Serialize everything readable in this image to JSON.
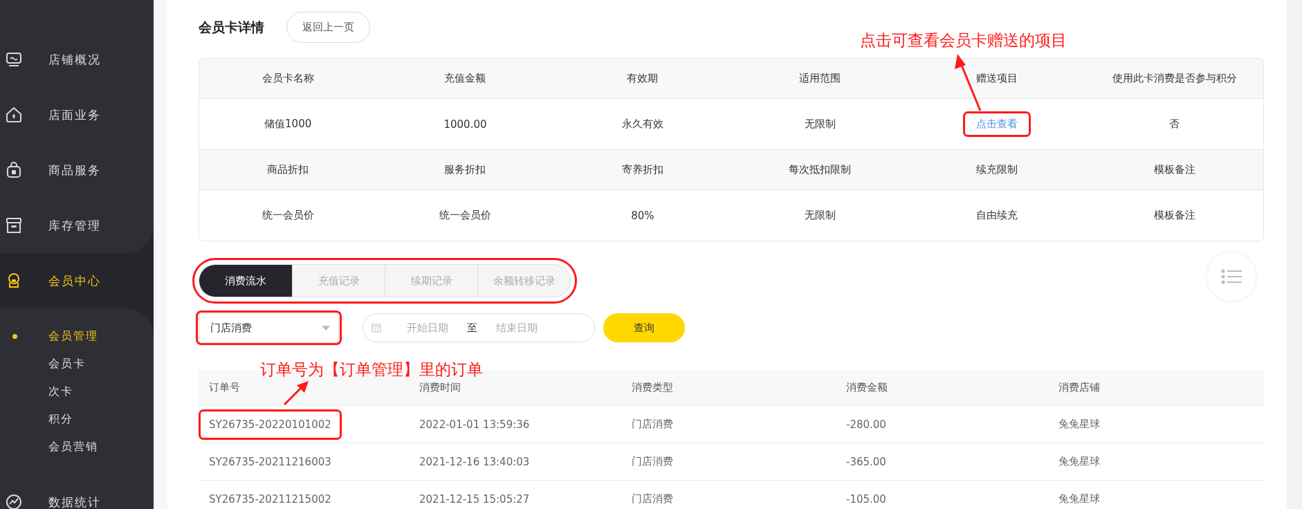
{
  "sidebar": {
    "items": [
      {
        "label": "店铺概况",
        "selected": false
      },
      {
        "label": "店面业务",
        "selected": false
      },
      {
        "label": "商品服务",
        "selected": false
      },
      {
        "label": "库存管理",
        "selected": false
      },
      {
        "label": "会员中心",
        "selected": true,
        "children": [
          {
            "label": "会员管理",
            "selected": true
          },
          {
            "label": "会员卡",
            "selected": false
          },
          {
            "label": "次卡",
            "selected": false
          },
          {
            "label": "积分",
            "selected": false
          },
          {
            "label": "会员营销",
            "selected": false
          }
        ]
      },
      {
        "label": "数据统计",
        "selected": false
      }
    ]
  },
  "page": {
    "title": "会员卡详情",
    "back_button": "返回上一页"
  },
  "card_table": {
    "rows": [
      {
        "kind": "header",
        "cells": [
          {
            "kind": "text",
            "text": "会员卡名称",
            "highlighted": false
          },
          {
            "kind": "text",
            "text": "充值金额",
            "highlighted": false
          },
          {
            "kind": "text",
            "text": "有效期",
            "highlighted": false
          },
          {
            "kind": "text",
            "text": "适用范围",
            "highlighted": false
          },
          {
            "kind": "text",
            "text": "赠送项目",
            "highlighted": false
          },
          {
            "kind": "text",
            "text": "使用此卡消费是否参与积分",
            "highlighted": false
          }
        ]
      },
      {
        "kind": "data",
        "cells": [
          {
            "kind": "text",
            "text": "储值1000",
            "highlighted": false
          },
          {
            "kind": "text",
            "text": "1000.00",
            "highlighted": false
          },
          {
            "kind": "text",
            "text": "永久有效",
            "highlighted": false
          },
          {
            "kind": "text",
            "text": "无限制",
            "highlighted": false
          },
          {
            "kind": "link",
            "text": "点击查看",
            "highlighted": true
          },
          {
            "kind": "text",
            "text": "否",
            "highlighted": false
          }
        ]
      },
      {
        "kind": "header",
        "cells": [
          {
            "kind": "text",
            "text": "商品折扣",
            "highlighted": false
          },
          {
            "kind": "text",
            "text": "服务折扣",
            "highlighted": false
          },
          {
            "kind": "text",
            "text": "寄养折扣",
            "highlighted": false
          },
          {
            "kind": "text",
            "text": "每次抵扣限制",
            "highlighted": false
          },
          {
            "kind": "text",
            "text": "续充限制",
            "highlighted": false
          },
          {
            "kind": "text",
            "text": "模板备注",
            "highlighted": false
          }
        ]
      },
      {
        "kind": "data",
        "cells": [
          {
            "kind": "text",
            "text": "统一会员价",
            "highlighted": false
          },
          {
            "kind": "text",
            "text": "统一会员价",
            "highlighted": false
          },
          {
            "kind": "text",
            "text": "80%",
            "highlighted": false
          },
          {
            "kind": "text",
            "text": "无限制",
            "highlighted": false
          },
          {
            "kind": "text",
            "text": "自由续充",
            "highlighted": false
          },
          {
            "kind": "text",
            "text": "模板备注",
            "highlighted": false
          }
        ]
      }
    ]
  },
  "record_tabs": {
    "highlighted": true,
    "tabs": [
      {
        "label": "消费流水",
        "selected": true
      },
      {
        "label": "充值记录",
        "selected": false
      },
      {
        "label": "续期记录",
        "selected": false
      },
      {
        "label": "余额转移记录",
        "selected": false
      }
    ]
  },
  "filters": {
    "type_select": {
      "value": "门店消费",
      "highlighted": true
    },
    "date_range": {
      "start_placeholder": "开始日期",
      "separator": "至",
      "end_placeholder": "结束日期"
    },
    "query_button": "查询"
  },
  "orders": {
    "columns": [
      "订单号",
      "消费时间",
      "消费类型",
      "消费金额",
      "消费店铺"
    ],
    "rows": [
      {
        "order_no_highlighted": true,
        "cells": [
          "SY26735-20220101002",
          "2022-01-01 13:59:36",
          "门店消费",
          "-280.00",
          "兔兔星球"
        ]
      },
      {
        "order_no_highlighted": false,
        "cells": [
          "SY26735-20211216003",
          "2021-12-16 13:40:03",
          "门店消费",
          "-365.00",
          "兔兔星球"
        ]
      },
      {
        "order_no_highlighted": false,
        "cells": [
          "SY26735-20211215002",
          "2021-12-15 15:05:27",
          "门店消费",
          "-105.00",
          "兔兔星球"
        ]
      }
    ]
  },
  "annotations": [
    {
      "text": "点击可查看会员卡赠送的项目"
    },
    {
      "text": "订单号为【订单管理】里的订单"
    }
  ]
}
